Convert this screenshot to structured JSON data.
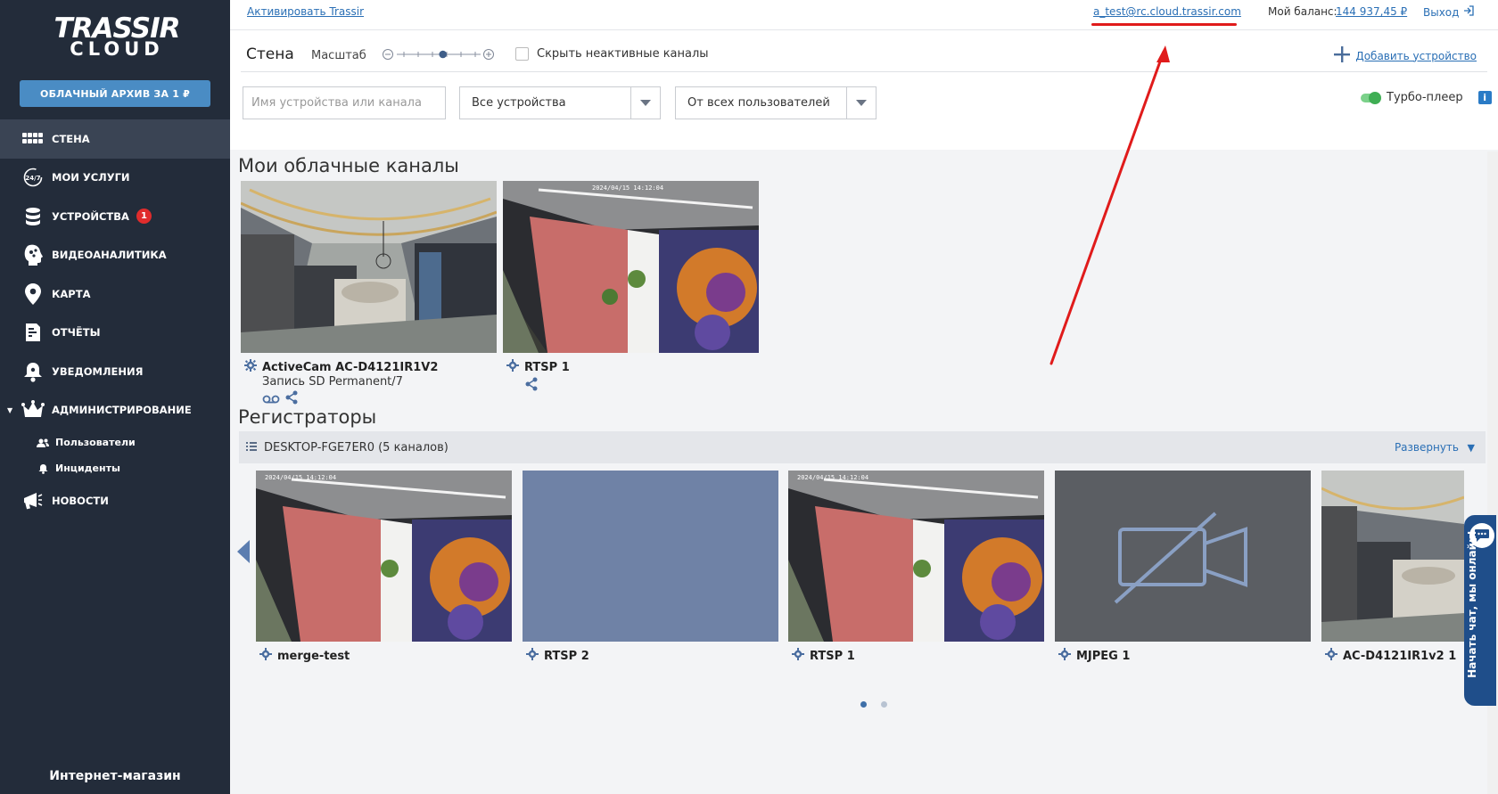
{
  "sidebar": {
    "logo_line1": "TRASSIR",
    "logo_line2": "CLOUD",
    "promo_label": "ОБЛАЧНЫЙ АРХИВ ЗА 1 ₽",
    "items": [
      {
        "label": "СТЕНА",
        "icon": "grid-icon"
      },
      {
        "label": "МОИ УСЛУГИ",
        "icon": "services-24-7-icon"
      },
      {
        "label": "УСТРОЙСТВА",
        "icon": "database-icon",
        "badge": "1"
      },
      {
        "label": "ВИДЕОАНАЛИТИКА",
        "icon": "analytics-head-icon"
      },
      {
        "label": "КАРТА",
        "icon": "map-pin-icon"
      },
      {
        "label": "ОТЧЁТЫ",
        "icon": "report-icon"
      },
      {
        "label": "УВЕДОМЛЕНИЯ",
        "icon": "bell-icon"
      },
      {
        "label": "АДМИНИСТРИРОВАНИЕ",
        "icon": "crown-icon"
      }
    ],
    "sub_items": [
      {
        "label": "Пользователи",
        "icon": "users-icon"
      },
      {
        "label": "Инциденты",
        "icon": "bell-small-icon"
      }
    ],
    "news_label": "НОВОСТИ",
    "shop_label": "Интернет-магазин"
  },
  "topbar": {
    "activate_link": "Активировать Trassir",
    "email": "a_test@rc.cloud.trassir.com",
    "balance_label": "Мой баланс:",
    "balance_value": "144 937,45 ₽",
    "logout_label": "Выход"
  },
  "toolbar": {
    "title": "Стена",
    "scale_label": "Масштаб",
    "zoom_level": 0.55,
    "hide_inactive_label": "Скрыть неактивные каналы",
    "add_device_label": "Добавить устройство"
  },
  "filters": {
    "search_placeholder": "Имя устройства или канала",
    "device_select": "Все устройства",
    "user_select": "От всех пользователей",
    "turbo_label": "Турбо-плеер",
    "turbo_on": true,
    "info_label": "i"
  },
  "cloud_section": {
    "title": "Мои облачные каналы",
    "channels": [
      {
        "name": "ActiveCam AC-D4121IR1V2",
        "sub": "Запись SD Permanent/7"
      },
      {
        "name": "RTSP 1",
        "sub": ""
      }
    ]
  },
  "registrars": {
    "title": "Регистраторы",
    "device": "DESKTOP-FGE7ER0 (5 каналов)",
    "expand_label": "Развернуть",
    "channels": [
      {
        "name": "merge-test"
      },
      {
        "name": "RTSP 2"
      },
      {
        "name": "RTSP 1"
      },
      {
        "name": "MJPEG 1"
      },
      {
        "name": "AC-D4121IR1v2 1"
      }
    ],
    "pages": 2,
    "current_page": 1
  },
  "chat": {
    "label": "Начать чат, мы онлайн!"
  },
  "colors": {
    "sidebar_bg": "#232c3a",
    "accent": "#2a6fb5",
    "promo": "#4a8cc4",
    "annotation": "#e01b1b",
    "placeholder_tile": "#6f82a6",
    "no_video_tile": "#5b5e63"
  }
}
